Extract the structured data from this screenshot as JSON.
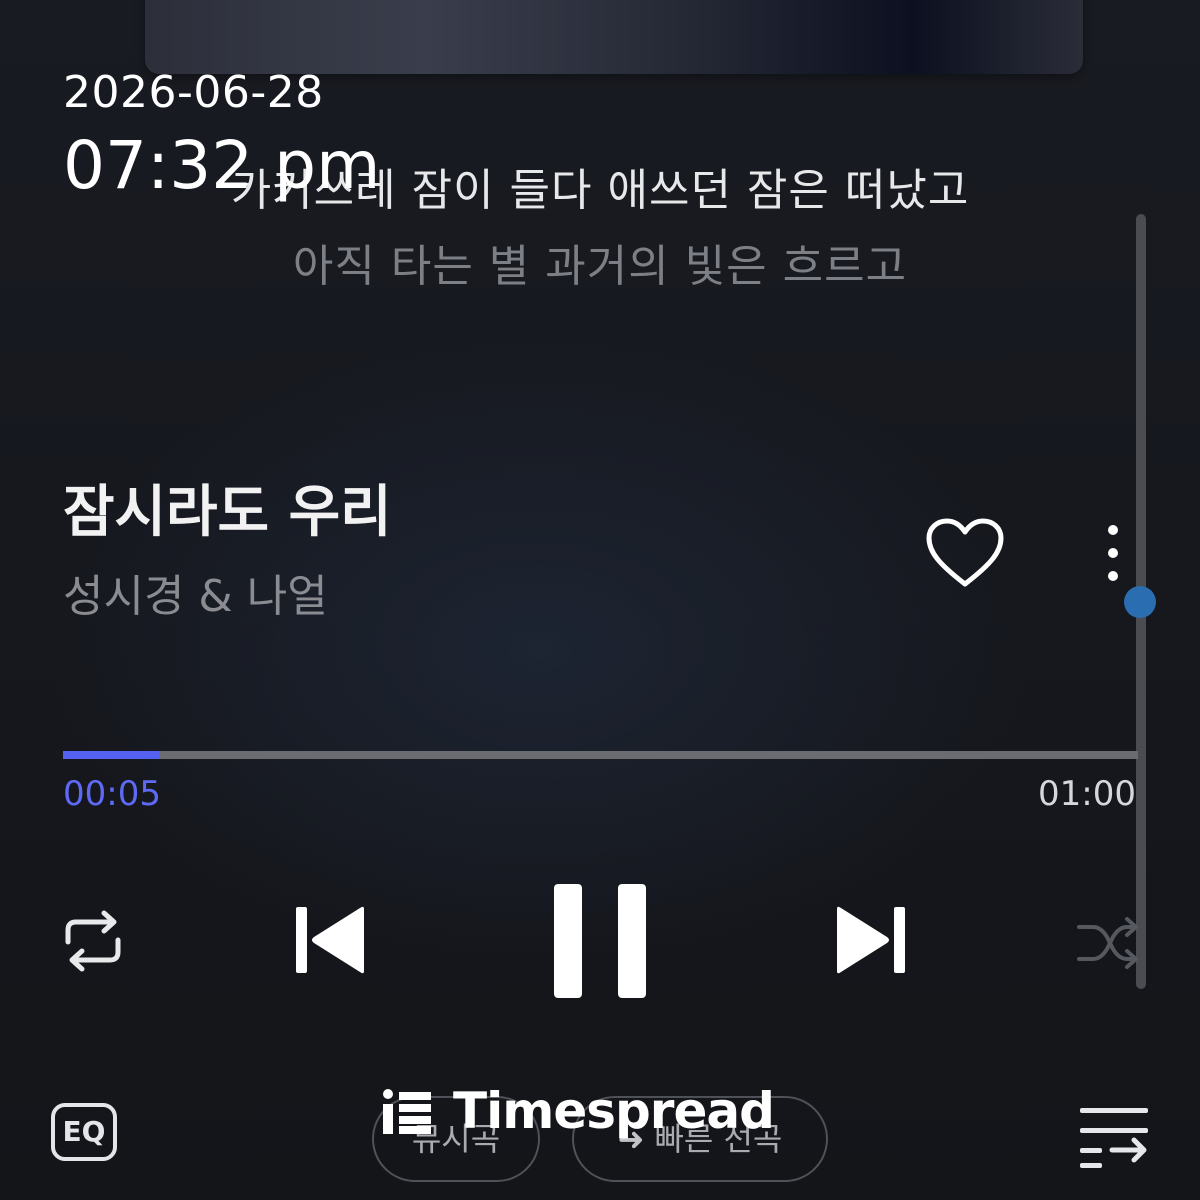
{
  "overlay": {
    "date": "2026-06-28",
    "time": "07:32 pm"
  },
  "lyrics": {
    "current": "카커쓰레 잠이 들다 애쓰던 잠은 떠났고",
    "next": "아직 타는 별 과거의 빛은 흐르고"
  },
  "track": {
    "title": "잠시라도 우리",
    "artist": "성시경 & 나얼",
    "liked": false
  },
  "playback": {
    "elapsed": "00:05",
    "duration": "01:00",
    "progress_fraction": 0.09,
    "state": "playing"
  },
  "controls": {
    "repeat_icon": "repeat-icon",
    "prev_icon": "skip-previous-icon",
    "pause_icon": "pause-icon",
    "next_icon": "skip-next-icon",
    "shuffle_icon": "shuffle-icon"
  },
  "bottom_bar": {
    "eq_label": "EQ",
    "pill_1_label": "뮤시곡",
    "pill_2_label": "빠른 선곡",
    "pill_2_arrow": "➜"
  },
  "watermark": {
    "text": "Timespread"
  },
  "colors": {
    "accent": "#5561f0",
    "background": "#16181e",
    "scroll_thumb": "#2a6db0"
  }
}
